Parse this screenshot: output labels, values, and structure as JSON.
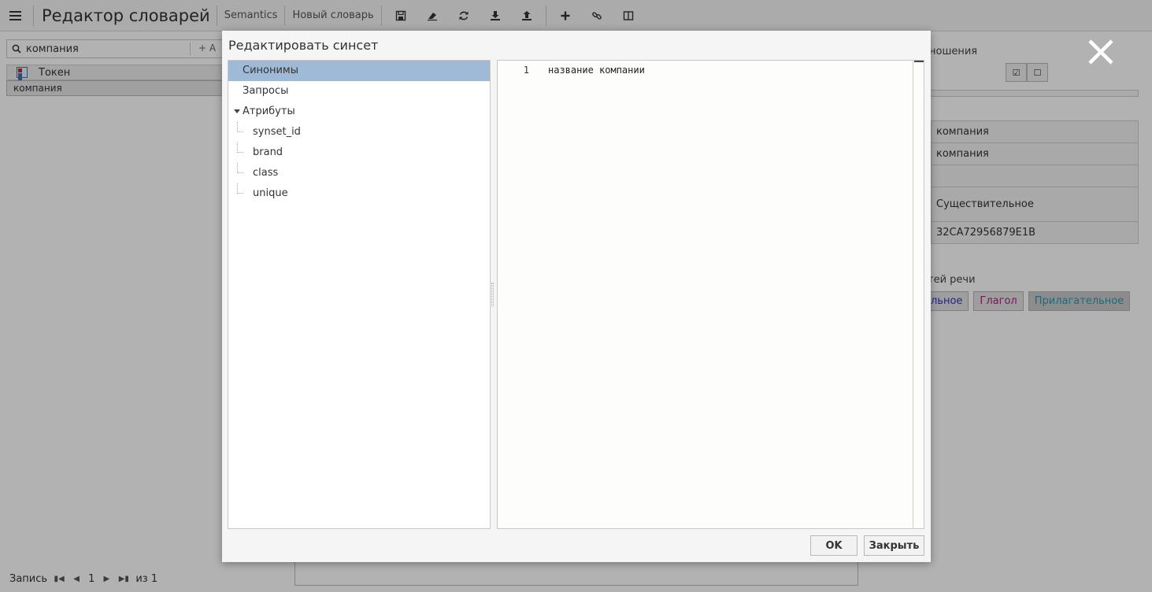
{
  "app": {
    "title": "Редактор словарей",
    "project": "Semantics",
    "dictionary": "Новый словарь"
  },
  "toolbar": {
    "icons": [
      "save-icon",
      "eraser-icon",
      "refresh-icon",
      "download-icon",
      "upload-icon",
      "plus-icon",
      "link-icon",
      "columns-icon"
    ]
  },
  "left_panel": {
    "search_value": "компания",
    "search_add": "+  A",
    "column_header": "Токен",
    "rows": [
      "компания"
    ]
  },
  "pager": {
    "label": "Запись",
    "page": "1",
    "total": "из 1"
  },
  "right_panel": {
    "label": "ношения",
    "table": [
      "компания",
      "компания",
      "",
      "Существительное",
      "32CA72956879E1B"
    ],
    "pos_label": "тей речи",
    "chips": {
      "noun": "ельное",
      "verb": "Глагол",
      "adj": "Прилагательное"
    }
  },
  "dialog": {
    "title": "Редактировать синсет",
    "tree": {
      "synonyms": "Синонимы",
      "queries": "Запросы",
      "attributes": "Атрибуты",
      "children": [
        "synset_id",
        "brand",
        "class",
        "unique"
      ]
    },
    "editor": {
      "line_number": "1",
      "line_text": "название компании"
    },
    "ok_label": "OK",
    "close_label": "Закрыть"
  },
  "colors": {
    "selected_tree_bg": "#9fbad6",
    "overlay": "rgba(0,0,0,0.30)",
    "noun_chip": "#3333cc",
    "verb_chip": "#b0207f",
    "adj_chip": "#1aa0b8"
  }
}
